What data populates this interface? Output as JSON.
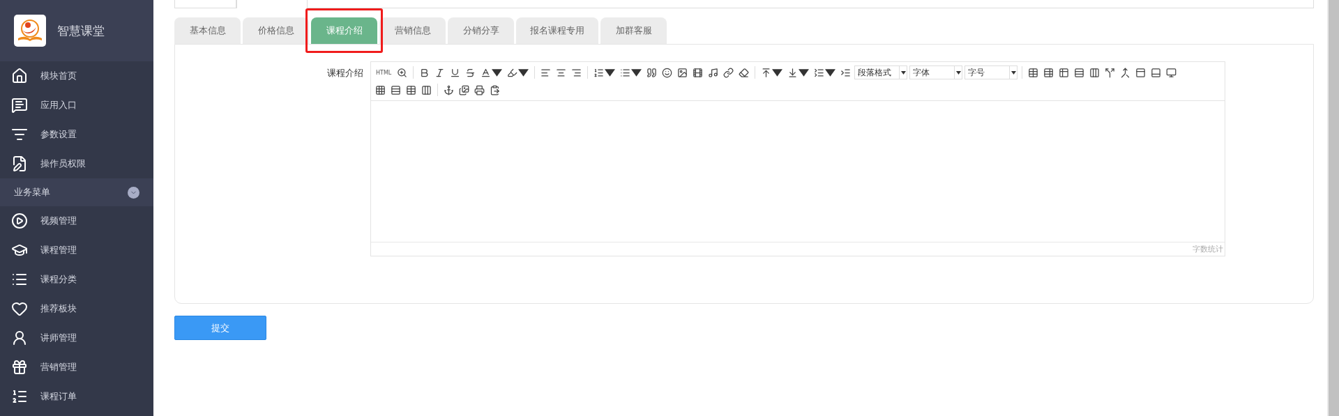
{
  "sidebar": {
    "brand": "智慧课堂",
    "items": [
      {
        "label": "模块首页"
      },
      {
        "label": "应用入口"
      },
      {
        "label": "参数设置"
      },
      {
        "label": "操作员权限"
      }
    ],
    "section": {
      "label": "业务菜单",
      "expanded": true
    },
    "section_items": [
      {
        "label": "视频管理"
      },
      {
        "label": "课程管理"
      },
      {
        "label": "课程分类"
      },
      {
        "label": "推荐板块"
      },
      {
        "label": "讲师管理"
      },
      {
        "label": "营销管理"
      },
      {
        "label": "课程订单"
      }
    ]
  },
  "tabs": [
    {
      "label": "基本信息",
      "selected": false,
      "highlighted": false
    },
    {
      "label": "价格信息",
      "selected": false,
      "highlighted": false
    },
    {
      "label": "课程介绍",
      "selected": true,
      "highlighted": true
    },
    {
      "label": "营销信息",
      "selected": false,
      "highlighted": false
    },
    {
      "label": "分销分享",
      "selected": false,
      "highlighted": false
    },
    {
      "label": "报名课程专用",
      "selected": false,
      "highlighted": false
    },
    {
      "label": "加群客服",
      "selected": false,
      "highlighted": false
    }
  ],
  "form": {
    "label": "课程介绍",
    "editor": {
      "html_button": "HTML",
      "paragraph_select": "段落格式",
      "font_select": "字体",
      "size_select": "字号",
      "word_count": "字数统计"
    }
  },
  "submit": "提交"
}
